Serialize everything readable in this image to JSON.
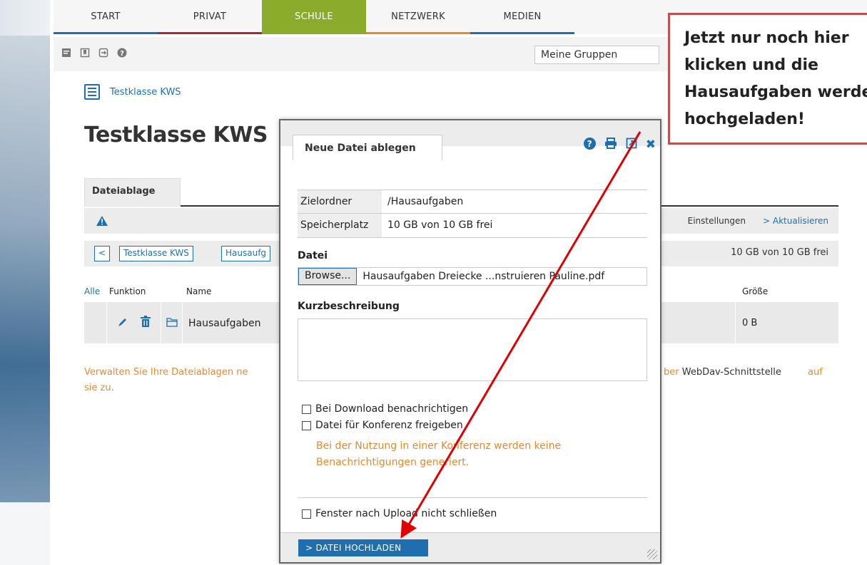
{
  "nav": {
    "tabs": [
      "START",
      "PRIVAT",
      "SCHULE",
      "NETZWERK",
      "MEDIEN"
    ],
    "groups_select": "Meine Gruppen"
  },
  "breadcrumb": {
    "link": "Testklasse KWS"
  },
  "page": {
    "title": "Testklasse KWS"
  },
  "filestore": {
    "tab": "Dateiablage",
    "settings": "Einstellungen",
    "refresh": "> Aktualisieren",
    "path_back": "<",
    "path_root": "Testklasse KWS",
    "path_sub": "Hausaufg",
    "free": "10 GB von 10 GB frei",
    "columns": {
      "all": "Alle",
      "function": "Funktion",
      "name": "Name",
      "size": "Größe"
    },
    "rows": [
      {
        "name": "Hausaufgaben",
        "size": "0 B"
      }
    ],
    "info_line1": "Verwalten Sie Ihre Dateiablagen ne",
    "info_webdav_pre": "ber ",
    "info_webdav": "WebDav-Schnittstelle",
    "info_auf": "auf",
    "info_line2": "sie zu."
  },
  "dialog": {
    "title": "Neue Datei ablegen",
    "target_label": "Zielordner",
    "target_value": "/Hausaufgaben",
    "space_label": "Speicherplatz",
    "space_value": "10 GB von 10 GB frei",
    "file_label": "Datei",
    "browse": "Browse...",
    "file_name": "Hausaufgaben Dreiecke ...nstruieren Pauline.pdf",
    "desc_label": "Kurzbeschreibung",
    "notify_download": "Bei Download benachrichtigen",
    "share_conference": "Datei für Konferenz freigeben",
    "conference_warning": "Bei der Nutzung in einer Konferenz werden keine Benachrichtigungen generiert.",
    "keep_open": "Fenster nach Upload nicht schließen",
    "upload_button": "> DATEI HOCHLADEN"
  },
  "annotation": {
    "lines": [
      "Jetzt nur noch hier",
      "klicken und die",
      "Hausaufgaben werden",
      "hochgeladen!"
    ],
    "color": "#c0504d",
    "arrow_color": "#e00000"
  },
  "colors": {
    "accent": "#1f6fb0",
    "schule": "#8aab2c",
    "warning": "#e6892a"
  }
}
